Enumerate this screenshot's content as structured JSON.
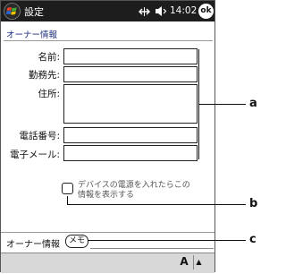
{
  "titlebar": {
    "title": "設定",
    "time": "14:02",
    "ok_label": "ok"
  },
  "tab_title": "オーナー情報",
  "fields": [
    {
      "label": "名前:",
      "value": ""
    },
    {
      "label": "勤務先:",
      "value": ""
    },
    {
      "label": "住所:",
      "value": ""
    },
    {
      "label": "電話番号:",
      "value": ""
    },
    {
      "label": "電子メール:",
      "value": ""
    }
  ],
  "checkbox": {
    "line1": "デバイスの電源を入れたらこの",
    "line2": "情報を表示する",
    "checked": false
  },
  "tabs": {
    "owner_label": "オーナー情報",
    "memo_label": "メモ"
  },
  "input_button_label": "A",
  "callouts": [
    "a",
    "b",
    "c"
  ]
}
